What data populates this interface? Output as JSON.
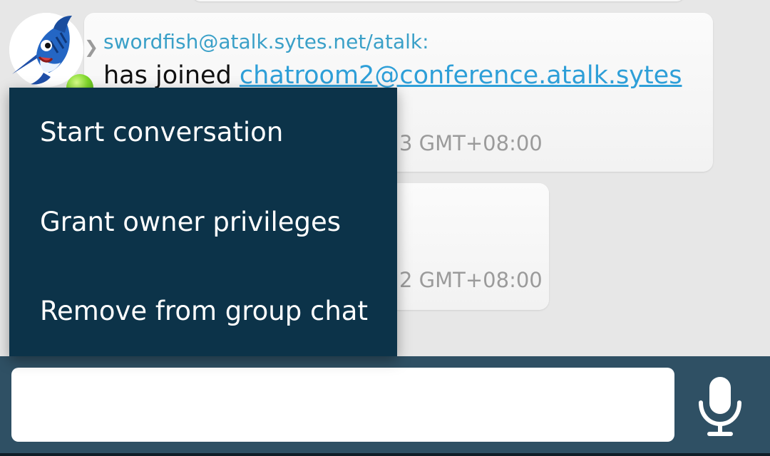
{
  "message": {
    "sender": "swordfish@atalk.sytes.net/atalk:",
    "text_prefix": "has joined ",
    "link_text": "chatroom2@conference.atalk.sytes",
    "timestamp_1_visible": "3 GMT+08:00",
    "timestamp_2_visible": "2 GMT+08:00",
    "avatar_icon": "swordfish-avatar-icon",
    "presence_status": "online",
    "presence_color": "#6cc61f"
  },
  "context_menu": {
    "items": [
      {
        "label": "Start conversation"
      },
      {
        "label": "Grant owner privileges"
      },
      {
        "label": "Remove from group chat"
      }
    ],
    "background": "#0c3349"
  },
  "input_bar": {
    "value": "",
    "placeholder": "",
    "mic_icon": "microphone-icon",
    "background": "#2f5064"
  },
  "colors": {
    "sender_color": "#3aa0c8",
    "link_color": "#2e9fd8"
  }
}
